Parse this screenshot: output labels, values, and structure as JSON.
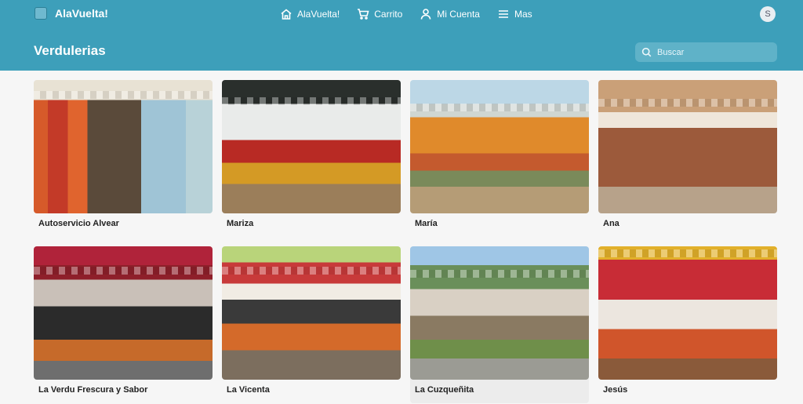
{
  "header": {
    "brand": "AlaVuelta!",
    "nav": [
      {
        "label": "AlaVuelta!",
        "icon": "home-icon"
      },
      {
        "label": "Carrito",
        "icon": "cart-icon"
      },
      {
        "label": "Mi Cuenta",
        "icon": "user-icon"
      },
      {
        "label": "Mas",
        "icon": "menu-icon"
      }
    ],
    "avatar_initial": "S",
    "page_title": "Verdulerias",
    "search_placeholder": "Buscar"
  },
  "stores": [
    {
      "name": "Autoservicio Alvear"
    },
    {
      "name": "Mariza"
    },
    {
      "name": "María"
    },
    {
      "name": "Ana"
    },
    {
      "name": "La Verdu Frescura y Sabor"
    },
    {
      "name": "La Vicenta"
    },
    {
      "name": "La Cuzqueñita"
    },
    {
      "name": "Jesús"
    }
  ],
  "colors": {
    "header": "#3d9fba",
    "background": "#f6f6f6"
  }
}
